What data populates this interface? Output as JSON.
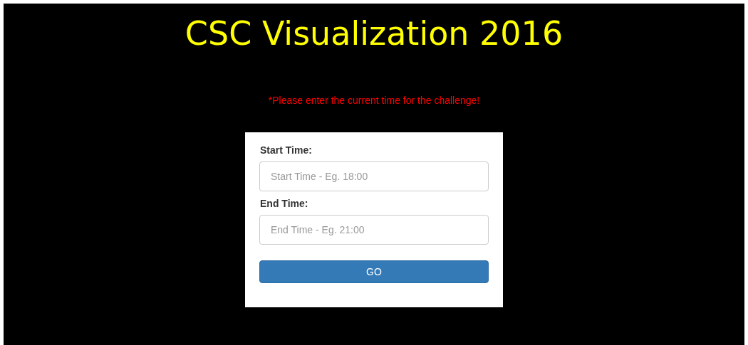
{
  "title": "CSC Visualization 2016",
  "notice": "*Please enter the current time for the challenge!",
  "form": {
    "fields": [
      {
        "label": "Start Time:",
        "placeholder": "Start Time - Eg. 18:00"
      },
      {
        "label": "End Time:",
        "placeholder": "End Time - Eg. 21:00"
      }
    ],
    "button": "GO"
  }
}
